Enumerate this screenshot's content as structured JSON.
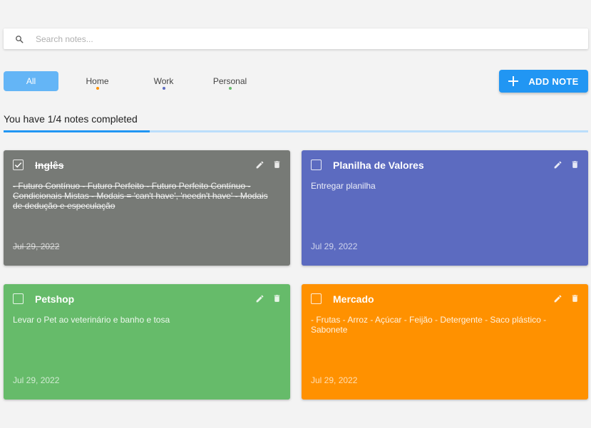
{
  "search": {
    "placeholder": "Search notes...",
    "icon": "search-icon"
  },
  "tabs": [
    {
      "label": "All",
      "active": true,
      "dot_color": null
    },
    {
      "label": "Home",
      "active": false,
      "dot_color": "#ff9100"
    },
    {
      "label": "Work",
      "active": false,
      "dot_color": "#5c6bc0"
    },
    {
      "label": "Personal",
      "active": false,
      "dot_color": "#66bb6a"
    }
  ],
  "add_button": {
    "label": "ADD NOTE",
    "icon": "plus-icon"
  },
  "progress": {
    "label": "You have 1/4 notes completed",
    "completed": 1,
    "total": 4
  },
  "notes": [
    {
      "title": "Inglês",
      "description": "- Futuro Contínuo - Futuro Perfeito - Futuro Perfeito Contínuo - Condicionais Mistas - Modais = 'can't have', 'needn't have' - Modais de dedução e especulação",
      "date": "Jul 29, 2022",
      "completed": true,
      "color": "#777a76"
    },
    {
      "title": "Planilha de Valores",
      "description": "Entregar planilha",
      "date": "Jul 29, 2022",
      "completed": false,
      "color": "#5c6bc0"
    },
    {
      "title": "Petshop",
      "description": "Levar o Pet ao veterinário e banho e tosa",
      "date": "Jul 29, 2022",
      "completed": false,
      "color": "#66bb6a"
    },
    {
      "title": "Mercado",
      "description": "- Frutas - Arroz - Açúcar - Feijão - Detergente - Saco plástico - Sabonete",
      "date": "Jul 29, 2022",
      "completed": false,
      "color": "#ff9100"
    }
  ],
  "colors": {
    "background": "#f3f3f3",
    "accent": "#2196f3",
    "active_tab": "#64b5f6",
    "progress_track": "#bbdefb"
  }
}
